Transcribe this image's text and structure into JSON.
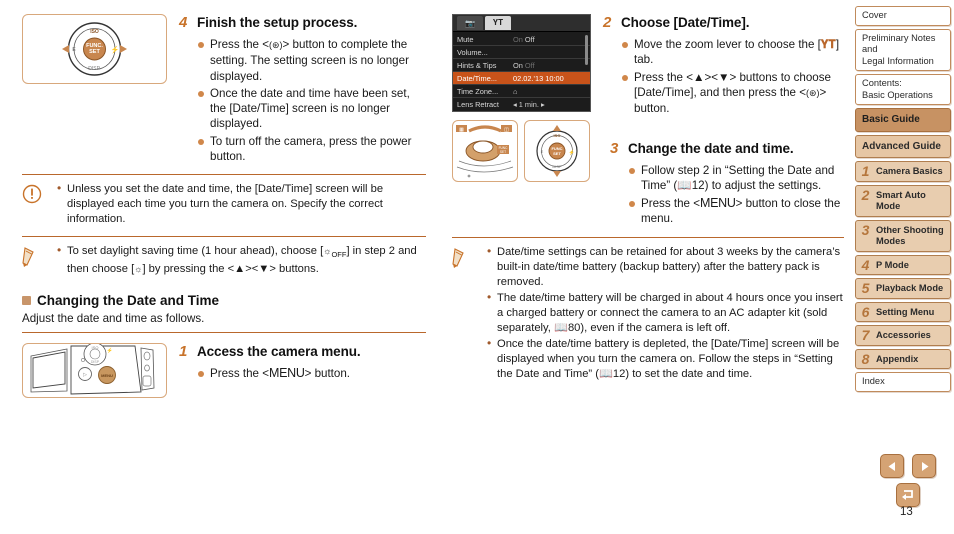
{
  "left_column": {
    "step4": {
      "number": "4",
      "title": "Finish the setup process.",
      "bullets": [
        "Press the <(FUNC SET)> button to complete the setting. The setting screen is no longer displayed.",
        "Once the date and time have been set, the [Date/Time] screen is no longer displayed.",
        "To turn off the camera, press the power button."
      ]
    },
    "warning_note": {
      "icon": "exclamation-icon",
      "items": [
        "Unless you set the date and time, the [Date/Time] screen will be displayed each time you turn the camera on. Specify the correct information."
      ]
    },
    "pencil_note": {
      "icon": "pencil-icon",
      "items": [
        "To set daylight saving time (1 hour ahead), choose [DST-OFF] in step 2 and then choose [DST-ON] by pressing the <▲><▼> buttons."
      ]
    },
    "section": {
      "heading": "Changing the Date and Time",
      "subtitle": "Adjust the date and time as follows."
    },
    "step1": {
      "number": "1",
      "title": "Access the camera menu.",
      "bullets": [
        "Press the <MENU> button."
      ]
    }
  },
  "mid_column": {
    "lcd": {
      "tabs": [
        "camera-tab",
        "wrench-tab"
      ],
      "selected_tab": "wrench-tab",
      "rows": [
        {
          "label": "Mute",
          "value_off": "On",
          "value_on": "Off",
          "highlight": false
        },
        {
          "label": "Volume...",
          "value_off": "",
          "value_on": "",
          "highlight": false
        },
        {
          "label": "Hints & Tips",
          "value_off": "On",
          "value_on": "Off",
          "highlight": false
        },
        {
          "label": "Date/Time...",
          "value_off": "",
          "value_on": "02.02.'13 10:00",
          "highlight": true
        },
        {
          "label": "Time Zone...",
          "value_off": "",
          "value_on": "⌂",
          "highlight": false
        },
        {
          "label": "Lens Retract",
          "value_off": "",
          "value_on": "◂ 1 min. ▸",
          "highlight": false
        }
      ]
    },
    "step2": {
      "number": "2",
      "title": "Choose [Date/Time].",
      "bullets": [
        "Move the zoom lever to choose the [ƒı] tab.",
        "Press the <▲><▼> buttons to choose [Date/Time], and then press the <(FUNC SET)> button."
      ]
    },
    "step3": {
      "number": "3",
      "title": "Change the date and time.",
      "bullets": [
        "Follow step 2 in “Setting the Date and Time” (📖12) to adjust the settings.",
        "Press the <MENU> button to close the menu."
      ]
    },
    "pencil_note": {
      "icon": "pencil-icon",
      "items": [
        "Date/time settings can be retained for about 3 weeks by the camera’s built-in date/time battery (backup battery) after the battery pack is removed.",
        "The date/time battery will be charged in about 4 hours once you insert a charged battery or connect the camera to an AC adapter kit (sold separately, 📖80), even if the camera is left off.",
        "Once the date/time battery is depleted, the [Date/Time] screen will be displayed when you turn the camera on. Follow the steps in “Setting the Date and Time” (📖12) to set the date and time."
      ]
    }
  },
  "sidebar": {
    "items": [
      {
        "label": "Cover",
        "style": "plain",
        "num": ""
      },
      {
        "label": "Preliminary Notes and Legal Information",
        "style": "plain",
        "num": ""
      },
      {
        "label": "Contents:\nBasic Operations",
        "style": "plain",
        "num": ""
      },
      {
        "label": "Basic Guide",
        "style": "active",
        "num": ""
      },
      {
        "label": "Advanced Guide",
        "style": "advanced",
        "num": ""
      },
      {
        "label": "Camera Basics",
        "style": "numbered",
        "num": "1"
      },
      {
        "label": "Smart Auto Mode",
        "style": "numbered",
        "num": "2"
      },
      {
        "label": "Other Shooting Modes",
        "style": "numbered",
        "num": "3"
      },
      {
        "label": "P Mode",
        "style": "numbered",
        "num": "4"
      },
      {
        "label": "Playback Mode",
        "style": "numbered",
        "num": "5"
      },
      {
        "label": "Setting Menu",
        "style": "numbered",
        "num": "6"
      },
      {
        "label": "Accessories",
        "style": "numbered",
        "num": "7"
      },
      {
        "label": "Appendix",
        "style": "numbered",
        "num": "8"
      },
      {
        "label": "Index",
        "style": "plain",
        "num": ""
      }
    ]
  },
  "footer": {
    "prev_icon": "left-triangle-icon",
    "next_icon": "right-triangle-icon",
    "back_icon": "return-arrow-icon",
    "page_number": "13"
  },
  "colors": {
    "accent": "#b9672c",
    "bullet": "#d0874a",
    "sidebar_bg": "#f0d9bf",
    "sidebar_active": "#c79263",
    "highlight": "#c8531a"
  }
}
